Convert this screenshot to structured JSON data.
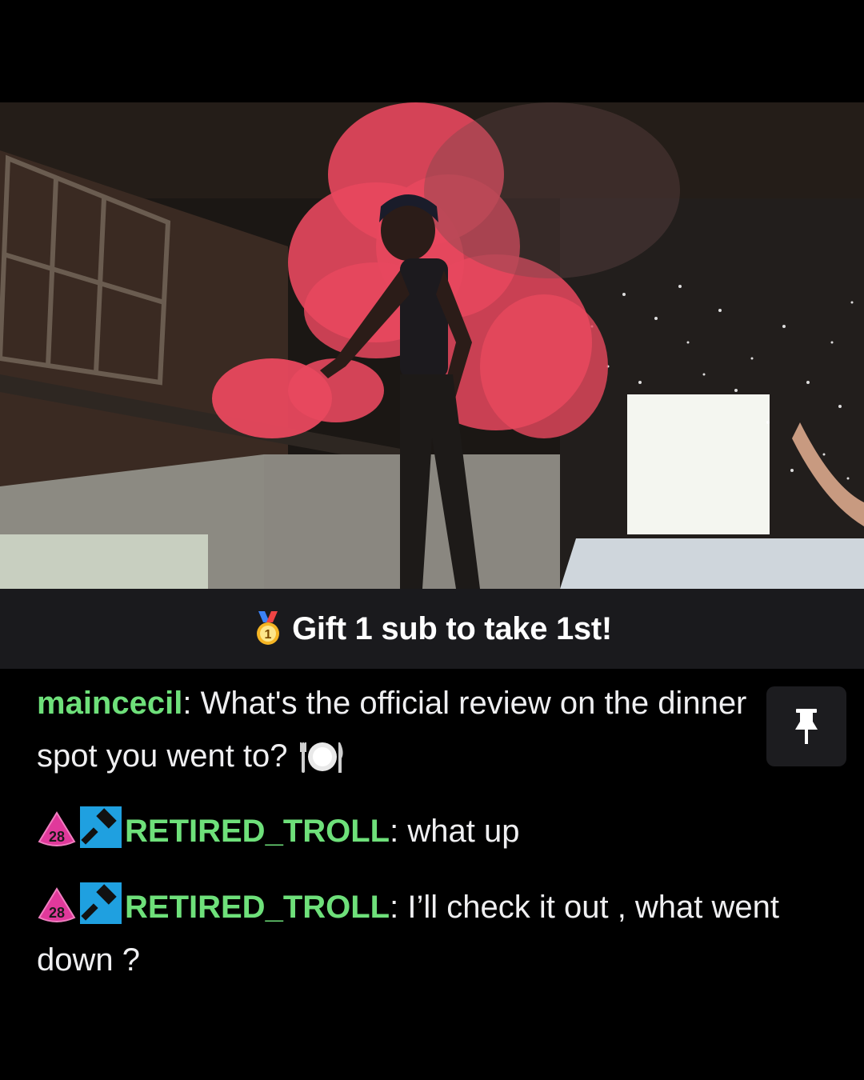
{
  "gift_banner": {
    "badge_icon": "first-place-medal-icon",
    "text": "Gift 1 sub to take 1st!"
  },
  "chat": {
    "pinned_message": {
      "username": "maincecil",
      "separator": ":",
      "text": " What's the official review on the dinner spot you went to?",
      "emoji": "plate-fork-knife-icon",
      "pin_icon": "pin-icon"
    },
    "messages": [
      {
        "badges": [
          {
            "type": "subscriber-badge",
            "label": "28",
            "color": "#e0399b"
          },
          {
            "type": "moderator-icon",
            "color": "#1fa0e0"
          }
        ],
        "username": "RETIRED_TROLL",
        "separator": ":",
        "text": " what up"
      },
      {
        "badges": [
          {
            "type": "subscriber-badge",
            "label": "28",
            "color": "#e0399b"
          },
          {
            "type": "moderator-icon",
            "color": "#1fa0e0"
          }
        ],
        "username": "RETIRED_TROLL",
        "separator": ":",
        "text": " I’ll check it out , what went down ?"
      }
    ]
  },
  "colors": {
    "username": "#6ee07a",
    "banner_bg": "#1a1a1d",
    "pin_bg": "#1c1c1f",
    "smoke": "#e8485e"
  }
}
